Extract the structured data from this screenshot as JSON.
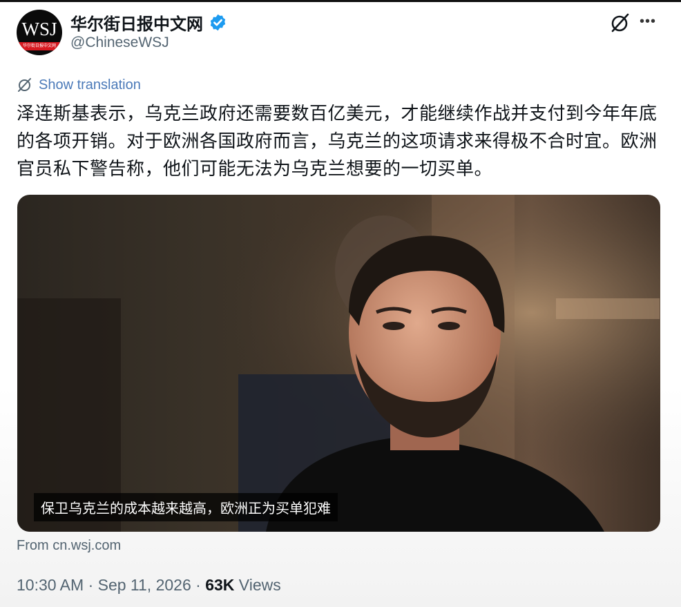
{
  "account": {
    "display_name": "华尔街日报中文网",
    "handle": "@ChineseWSJ",
    "avatar_text": "WSJ",
    "avatar_subtext": "华尔街日报中文网",
    "verified": true
  },
  "actions": {
    "grok_icon": "grok-icon",
    "more_label": "•••"
  },
  "translate": {
    "label": "Show translation"
  },
  "tweet": {
    "text": "泽连斯基表示，乌克兰政府还需要数百亿美元，才能继续作战并支付到今年年底的各项开销。对于欧洲各国政府而言，乌克兰的这项请求来得极不合时宜。欧洲官员私下警告称，他们可能无法为乌克兰想要的一切买单。"
  },
  "media": {
    "caption": "保卫乌克兰的成本越来越高，欧洲正为买单犯难"
  },
  "card": {
    "source": "From cn.wsj.com"
  },
  "meta": {
    "time_date": "10:30 AM · Sep 11, 2026 · ",
    "views_count": "63K",
    "views_label": " Views"
  },
  "colors": {
    "verified_blue": "#1d9bf0",
    "secondary_text": "#536471",
    "wsj_red": "#d71920"
  }
}
